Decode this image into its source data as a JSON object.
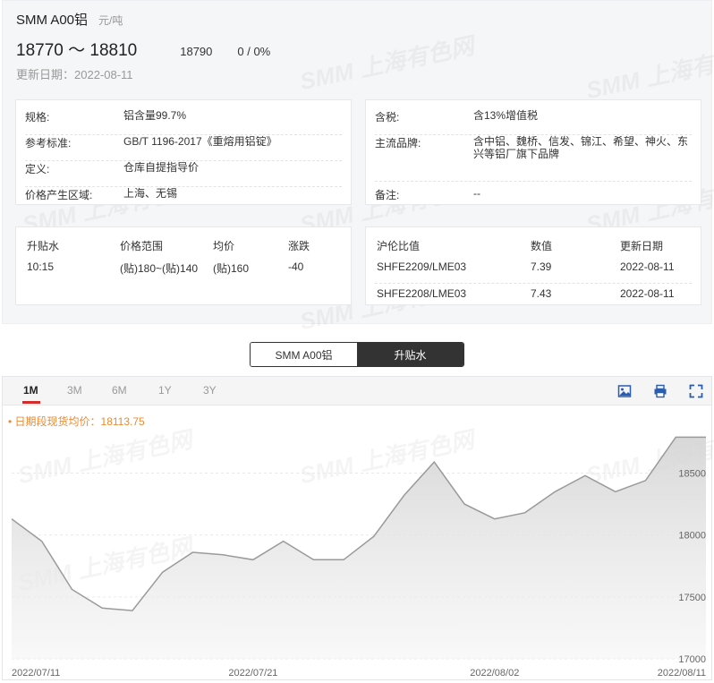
{
  "header": {
    "product": "SMM A00铝",
    "unit": "元/吨",
    "price_range": "18770 ～ 18810",
    "price_avg": "18790",
    "price_change": "0 / 0%",
    "update_date": "更新日期：2022-08-11"
  },
  "specs_left": [
    {
      "key": "规格:",
      "value": "铝含量99.7%"
    },
    {
      "key": "参考标准:",
      "value": "GB/T 1196-2017《重熔用铝锭》"
    },
    {
      "key": "定义:",
      "value": "仓库自提指导价"
    },
    {
      "key": "价格产生区域:",
      "value": "上海、无锡"
    }
  ],
  "specs_right": [
    {
      "key": "含税:",
      "value": "含13%增值税"
    },
    {
      "key": "主流品牌:",
      "value": "含中铝、魏桥、信发、锦江、希望、神火、东兴等铝厂旗下品牌"
    },
    {
      "key": "备注:",
      "value": "--"
    }
  ],
  "premium_table": {
    "headers": [
      "升贴水",
      "价格范围",
      "均价",
      "涨跌"
    ],
    "rows": [
      [
        "10:15",
        "(贴)180~(贴)140",
        "(贴)160",
        "-40"
      ]
    ]
  },
  "ratio_table": {
    "headers": [
      "沪伦比值",
      "数值",
      "更新日期"
    ],
    "rows": [
      [
        "SHFE2209/LME03",
        "7.39",
        "2022-08-11"
      ],
      [
        "SHFE2208/LME03",
        "7.43",
        "2022-08-11"
      ]
    ]
  },
  "toggle": {
    "option1": "SMM A00铝",
    "option2": "升贴水"
  },
  "range_tabs": [
    "1M",
    "3M",
    "6M",
    "1Y",
    "3Y"
  ],
  "active_range": "1M",
  "tools": {
    "image": "image-icon",
    "print": "print-icon",
    "fullscreen": "fullscreen-icon"
  },
  "avg_label": "• 日期段现货均价：18113.75",
  "watermark_text": "SMM 上海有色网",
  "colors": {
    "accent_red": "#d22c2c",
    "avg_orange": "#ee8a2e",
    "line": "#9a9a9a"
  },
  "chart_data": {
    "type": "area",
    "x": [
      "2022/07/11",
      "2022/07/12",
      "2022/07/13",
      "2022/07/14",
      "2022/07/15",
      "2022/07/18",
      "2022/07/19",
      "2022/07/20",
      "2022/07/21",
      "2022/07/22",
      "2022/07/25",
      "2022/07/26",
      "2022/07/27",
      "2022/07/28",
      "2022/07/29",
      "2022/08/01",
      "2022/08/02",
      "2022/08/03",
      "2022/08/04",
      "2022/08/05",
      "2022/08/08",
      "2022/08/09",
      "2022/08/10",
      "2022/08/11"
    ],
    "values": [
      18130,
      17950,
      17560,
      17410,
      17390,
      17700,
      17860,
      17840,
      17800,
      17950,
      17800,
      17800,
      17990,
      18320,
      18590,
      18250,
      18130,
      18180,
      18350,
      18480,
      18350,
      18440,
      18790,
      18790
    ],
    "x_tick_labels": [
      "2022/07/11",
      "2022/07/21",
      "2022/08/02",
      "2022/08/11"
    ],
    "y_ticks": [
      17000,
      17500,
      18000,
      18500
    ],
    "ylim": [
      17000,
      18800
    ],
    "grid": true
  }
}
